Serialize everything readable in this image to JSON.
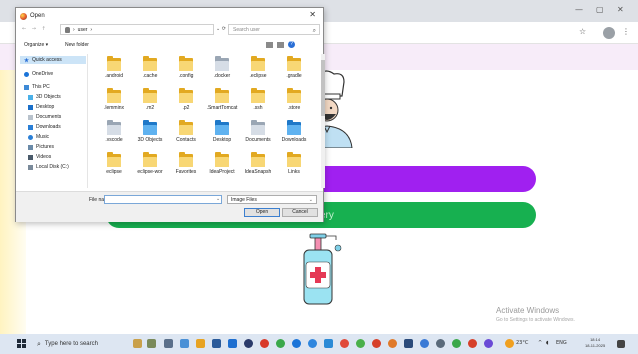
{
  "dialog": {
    "title": "Open",
    "close_glyph": "✕",
    "address": {
      "back_forward_up": "← → ↑",
      "path_user": "user",
      "path_sep": "›",
      "dropdown_glyph": "⌄",
      "refresh_glyph": "⟳",
      "search_placeholder": "Search user",
      "search_icon": "search-icon"
    },
    "toolbar": {
      "organize": "Organize ▾",
      "new_folder": "New folder"
    },
    "nav": [
      {
        "label": "Quick access",
        "icon": "star-icon"
      },
      {
        "label": "OneDrive",
        "icon": "cloud-icon"
      },
      {
        "label": "This PC",
        "icon": "computer-icon"
      },
      {
        "label": "3D Objects",
        "icon": "cube-icon"
      },
      {
        "label": "Desktop",
        "icon": "desktop-icon"
      },
      {
        "label": "Documents",
        "icon": "document-icon"
      },
      {
        "label": "Downloads",
        "icon": "download-icon"
      },
      {
        "label": "Music",
        "icon": "music-icon"
      },
      {
        "label": "Pictures",
        "icon": "picture-icon"
      },
      {
        "label": "Videos",
        "icon": "video-icon"
      },
      {
        "label": "Local Disk (C:)",
        "icon": "drive-icon"
      }
    ],
    "files": [
      {
        "name": ".android"
      },
      {
        "name": ".cache"
      },
      {
        "name": ".config"
      },
      {
        "name": ".docker"
      },
      {
        "name": ".eclipse"
      },
      {
        "name": ".gradle"
      },
      {
        "name": ".lemminx"
      },
      {
        "name": ".m2"
      },
      {
        "name": ".p2"
      },
      {
        "name": ".SmartTomcat"
      },
      {
        "name": ".ssh"
      },
      {
        "name": ".store"
      },
      {
        "name": ".vscode"
      },
      {
        "name": "3D Objects"
      },
      {
        "name": "Contacts"
      },
      {
        "name": "Desktop"
      },
      {
        "name": "Documents"
      },
      {
        "name": "Downloads"
      },
      {
        "name": "eclipse"
      },
      {
        "name": "eclipse-wor"
      },
      {
        "name": "Favorites"
      },
      {
        "name": "IdeaProject"
      },
      {
        "name": "IdeaSnapsh"
      },
      {
        "name": "Links"
      }
    ],
    "footer": {
      "file_name_label": "File name:",
      "file_name_value": "",
      "file_type": "Image Files",
      "open": "Open",
      "cancel": "Cancel"
    }
  },
  "app": {
    "green_button_text": "ery"
  },
  "watermark": {
    "title": "Activate Windows",
    "subtitle": "Go to Settings to activate Windows."
  },
  "taskbar": {
    "search_placeholder": "Type here to search",
    "weather": "23°C",
    "lang": "ENG",
    "time": "18:14",
    "date": "18-11-2025"
  },
  "colors": {
    "purple_button": "#a020f0",
    "green_button": "#17b050",
    "folder": "#f8d775",
    "selection": "#cce4f7"
  }
}
